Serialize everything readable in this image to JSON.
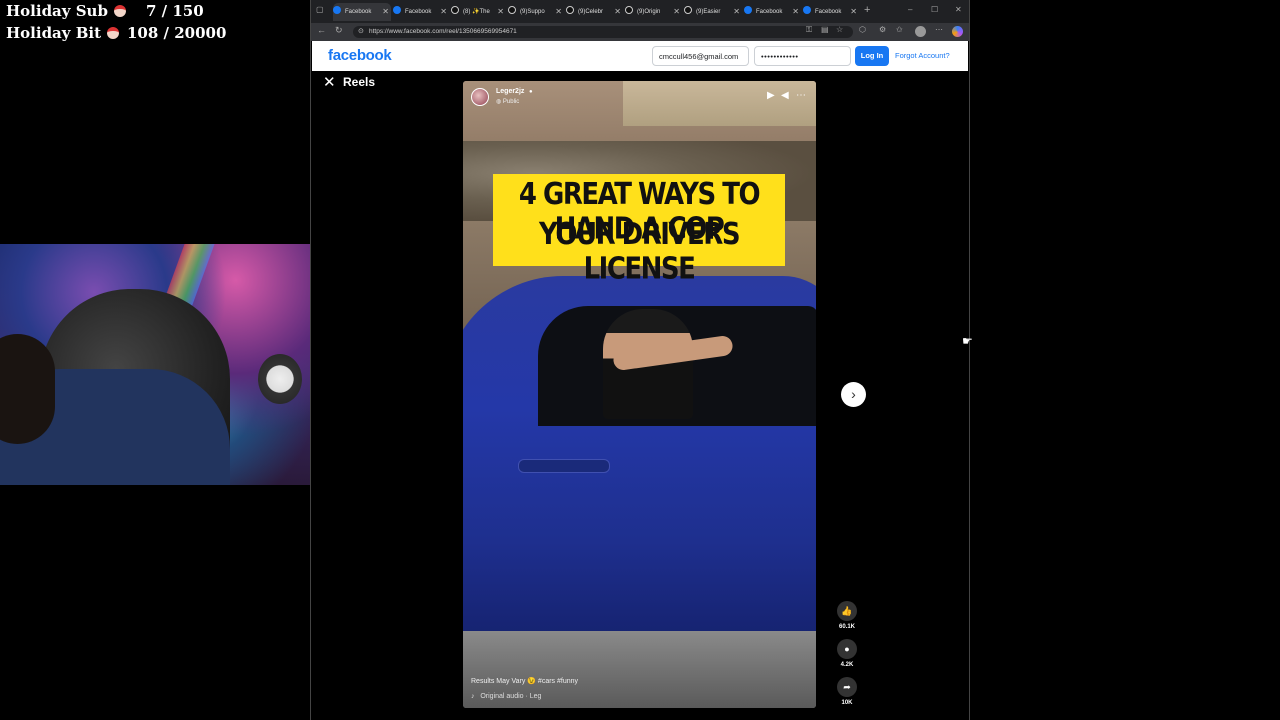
{
  "overlay": {
    "goals": [
      {
        "label": "Holiday Sub",
        "value": "7 / 150"
      },
      {
        "label": "Holiday Bit",
        "value": "108 / 20000"
      }
    ]
  },
  "browser": {
    "tabs": [
      {
        "label": "Facebook",
        "icon": "facebook-icon",
        "active": true
      },
      {
        "label": "Facebook",
        "icon": "facebook-icon",
        "active": false
      },
      {
        "label": "(8) ✨The",
        "icon": "tiktok-icon",
        "active": false
      },
      {
        "label": "(9)Suppo",
        "icon": "tiktok-icon",
        "active": false
      },
      {
        "label": "(9)Celebr",
        "icon": "tiktok-icon",
        "active": false
      },
      {
        "label": "(9)Origin",
        "icon": "tiktok-icon",
        "active": false
      },
      {
        "label": "(9)Easier",
        "icon": "tiktok-icon",
        "active": false
      },
      {
        "label": "Facebook",
        "icon": "facebook-icon",
        "active": false
      },
      {
        "label": "Facebook",
        "icon": "facebook-icon",
        "active": false
      }
    ],
    "new_tab": "+",
    "window_controls": {
      "minimize": "–",
      "maximize": "☐",
      "close": "✕"
    },
    "url": "https://www.facebook.com/reel/1350669569954671"
  },
  "facebook": {
    "logo": "facebook",
    "email_value": "cmccull456@gmail.com",
    "password_value": "••••••••••••",
    "login_label": "Log In",
    "forgot_label": "Forgot Account?",
    "reels_title": "Reels",
    "brand_color": "#1877f2"
  },
  "reel": {
    "username": "Leger2jz",
    "privacy": "Public",
    "banner_line1": "4 GREAT WAYS TO HAND A COP",
    "banner_line2": "YOUR DRIVERS LICENSE",
    "caption": "Results May Vary 😉 #cars #funny",
    "audio": "Original audio · Leg",
    "likes": "60.1K",
    "comments": "4.2K",
    "shares": "10K"
  }
}
